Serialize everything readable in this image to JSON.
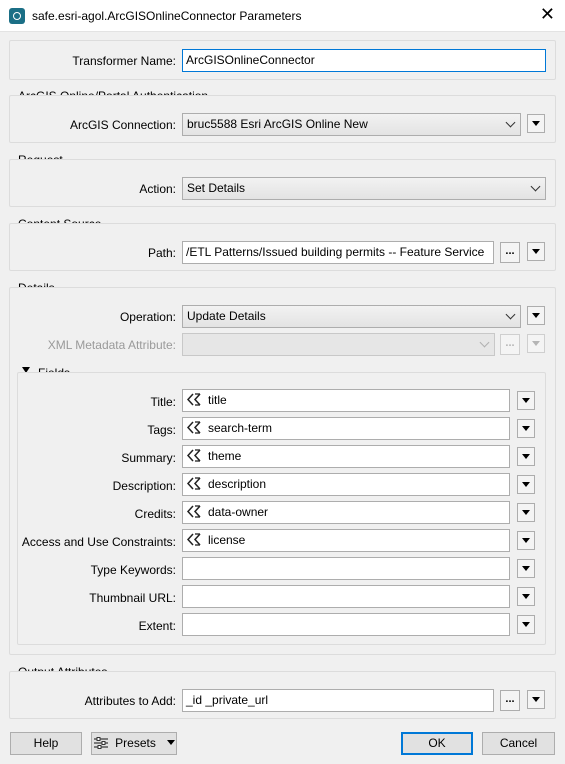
{
  "window": {
    "title": "safe.esri-agol.ArcGISOnlineConnector Parameters"
  },
  "transformer": {
    "label": "Transformer Name:",
    "value": "ArcGISOnlineConnector"
  },
  "auth": {
    "section_title": "ArcGIS Online/Portal Authentication",
    "connection_label": "ArcGIS Connection:",
    "connection_value": "bruc5588 Esri ArcGIS Online New"
  },
  "request": {
    "section_title": "Request",
    "action_label": "Action:",
    "action_value": "Set Details"
  },
  "content_source": {
    "section_title": "Content Source",
    "path_label": "Path:",
    "path_value": "/ETL Patterns/Issued building permits -- Feature Service",
    "browse_label": "..."
  },
  "details": {
    "section_title": "Details",
    "operation_label": "Operation:",
    "operation_value": "Update Details",
    "xml_label": "XML Metadata Attribute:",
    "xml_value": "",
    "browse_label": "...",
    "fields_title": "Fields",
    "fields": [
      {
        "label": "Title:",
        "value": "title",
        "attr": true
      },
      {
        "label": "Tags:",
        "value": "search-term",
        "attr": true
      },
      {
        "label": "Summary:",
        "value": "theme",
        "attr": true
      },
      {
        "label": "Description:",
        "value": "description",
        "attr": true
      },
      {
        "label": "Credits:",
        "value": "data-owner",
        "attr": true
      },
      {
        "label": "Access and Use Constraints:",
        "value": "license",
        "attr": true
      },
      {
        "label": "Type Keywords:",
        "value": "",
        "attr": false
      },
      {
        "label": "Thumbnail URL:",
        "value": "",
        "attr": false
      },
      {
        "label": "Extent:",
        "value": "",
        "attr": false
      }
    ]
  },
  "output": {
    "section_title": "Output Attributes",
    "attributes_label": "Attributes to Add:",
    "attributes_value": "_id _private_url",
    "browse_label": "..."
  },
  "footer": {
    "help": "Help",
    "presets": "Presets",
    "ok": "OK",
    "cancel": "Cancel"
  },
  "colors": {
    "accent": "#0078d7",
    "background": "#f0f0f0",
    "app_icon": "#1b6f86"
  },
  "icons": {
    "app": "fme-transformer-icon",
    "attribute": "attribute-value-icon",
    "menu": "triangle-down-icon",
    "close": "close-icon"
  }
}
